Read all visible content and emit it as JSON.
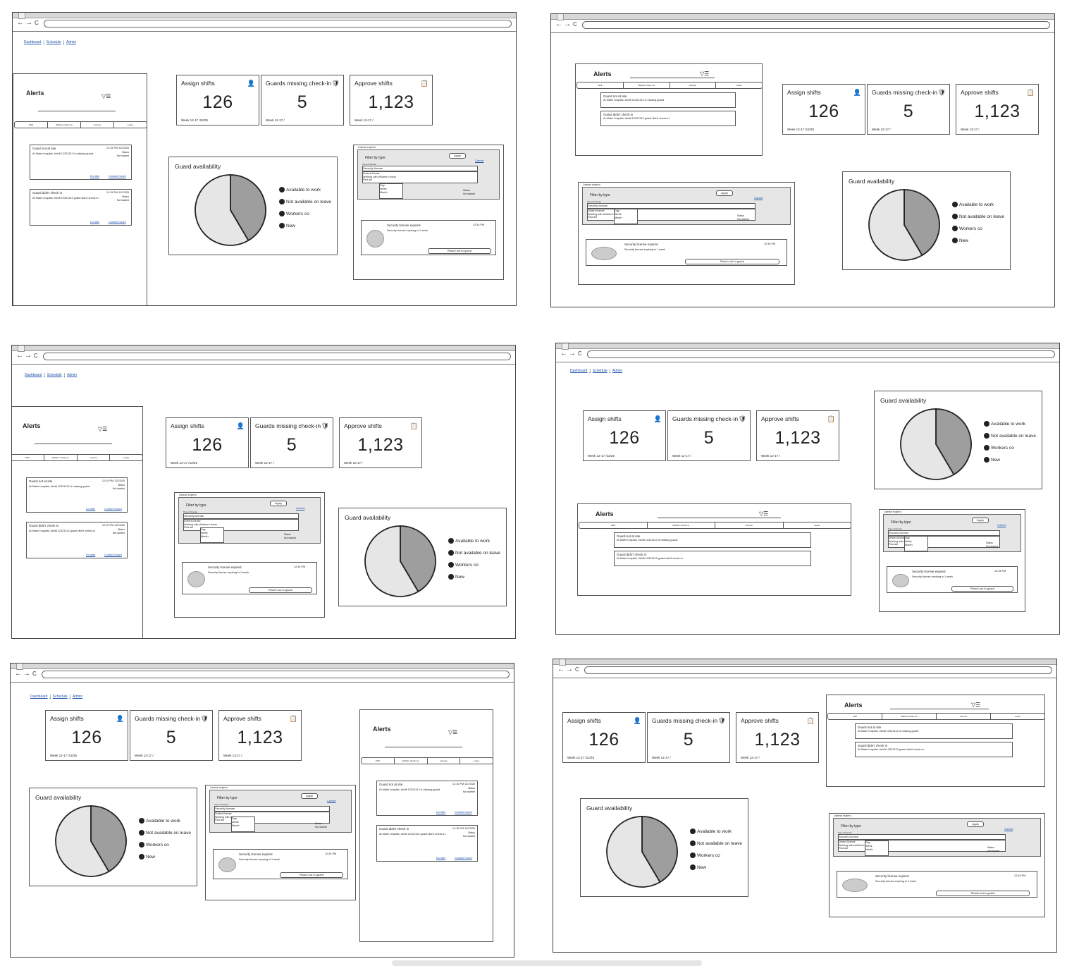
{
  "nav": {
    "dashboard": "Dashboard",
    "schedule": "Schedule",
    "admin": "Admin",
    "sep": "|"
  },
  "browser": {
    "back": "←",
    "forward": "→",
    "reload": "C"
  },
  "cards": {
    "assign": {
      "title": "Assign shifts",
      "value": "126",
      "footer": "Week 12-17 /12/25",
      "icon": "add-user-icon"
    },
    "missing": {
      "title": "Guards missing check-in",
      "value": "5",
      "footer": "Week 12-17 /",
      "icon": "guard-alert-icon"
    },
    "approve": {
      "title": "Approve shifts",
      "value": "1,123",
      "footer": "Week 12-17 /",
      "icon": "clipboard-check-icon"
    }
  },
  "availability": {
    "title": "Guard availability",
    "legend": [
      "Available to work",
      "Not available on leave",
      "Workers co",
      "New"
    ]
  },
  "alerts": {
    "title": "Alerts",
    "filter_icon": "▽☰",
    "tabs": [
      "Shift",
      "Welfare check-ins",
      "License",
      "Leave"
    ],
    "items": [
      {
        "title": "Guard not at site",
        "desc": "At Mater hospital, #shift 12321312 is missing guard.",
        "time": "12:15 PM 12/23/25",
        "status_label": "Status",
        "status": "Not started",
        "later": "Do later",
        "contact": "Contact Guard"
      },
      {
        "title": "Guard didn't check in",
        "desc": "At Mater hospital, #shift 12321312 guard didn't check-in.",
        "time": "12:15 PM 12/23/25",
        "status_label": "Status",
        "status": "Not started",
        "later": "Do later",
        "contact": "Contact Guard"
      }
    ]
  },
  "license": {
    "label": "License expired",
    "filter_title": "Filter by type",
    "apply": "Apply",
    "cancel": "Cancel",
    "type_label": "Type of license",
    "selected": "Security license",
    "options": [
      "Drivers license",
      "Working with children's check",
      "First aid"
    ],
    "period_options": [
      "Day",
      "Week",
      "Month"
    ],
    "status_label": "Status",
    "status": "Not started",
    "exp_title": "Security license expired",
    "exp_desc": "Security license expiring in 1 week",
    "exp_time": "12:34 PM",
    "reach_out": "Reach out to guard"
  },
  "pie": {
    "slices": [
      {
        "label": "dark",
        "value": 0.415,
        "color": "#9e9e9e"
      },
      {
        "label": "light",
        "value": 0.585,
        "color": "#e6e6e6"
      }
    ]
  }
}
